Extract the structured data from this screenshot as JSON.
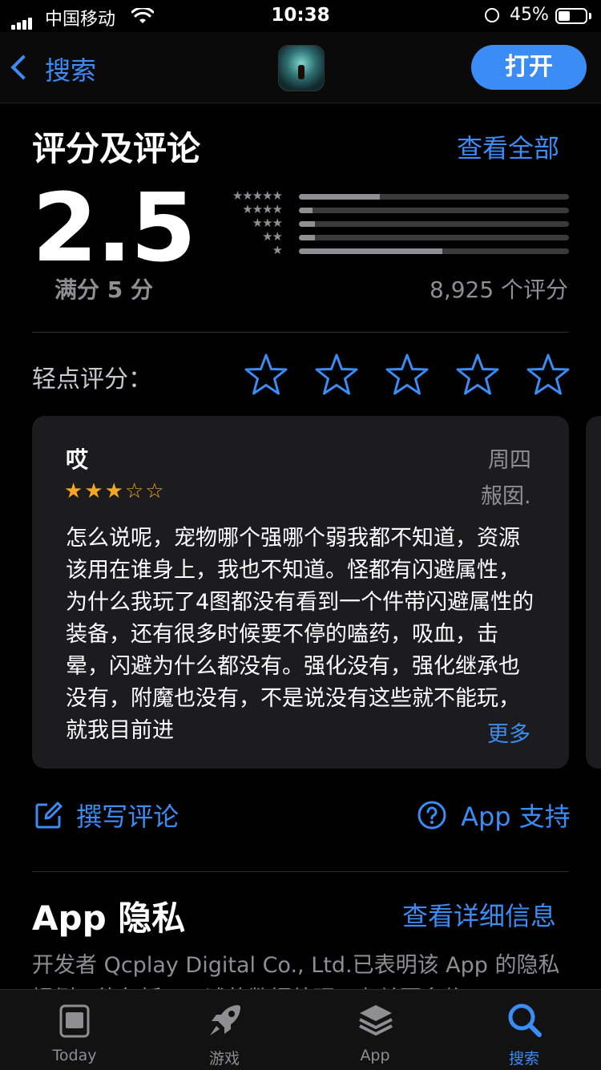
{
  "status": {
    "carrier": "中国移动",
    "time": "10:38",
    "battery": "45%"
  },
  "nav": {
    "back_label": "搜索",
    "open_label": "打开"
  },
  "ratings": {
    "title": "评分及评论",
    "see_all": "查看全部",
    "score": "2.5",
    "out_of": "满分 5 分",
    "count": "8,925 个评分",
    "distribution": [
      {
        "stars": "★★★★★",
        "fraction": 0.3
      },
      {
        "stars": "★★★★",
        "fraction": 0.05
      },
      {
        "stars": "★★★",
        "fraction": 0.06
      },
      {
        "stars": "★★",
        "fraction": 0.06
      },
      {
        "stars": "★",
        "fraction": 0.53
      }
    ],
    "tap_to_rate": "轻点评分："
  },
  "review": {
    "title": "哎",
    "date": "周四",
    "author": "赧囡.",
    "stars": "★★★☆☆",
    "star_count": 3,
    "body": "怎么说呢，宠物哪个强哪个弱我都不知道，资源该用在谁身上，我也不知道。怪都有闪避属性，为什么我玩了4图都没有看到一个件带闪避属性的装备，还有很多时候要不停的嗑药，吸血，击晕，闪避为什么都没有。强化没有，强化继承也没有，附魔也没有，不是说没有这些就不能玩，就我目前进",
    "more": "更多"
  },
  "actions": {
    "write_review": "撰写评论",
    "app_support": "App 支持"
  },
  "privacy": {
    "title": "App 隐私",
    "details": "查看详细信息",
    "text": "开发者 Qcplay Digital Co., Ltd.已表明该 App 的隐私慣例可能包括了下述的数据处理。有关更多信"
  },
  "tabs": [
    {
      "label": "Today",
      "icon": "today-icon",
      "active": false
    },
    {
      "label": "游戏",
      "icon": "rocket-icon",
      "active": false
    },
    {
      "label": "App",
      "icon": "layers-icon",
      "active": false
    },
    {
      "label": "搜索",
      "icon": "search-icon",
      "active": true
    }
  ],
  "colors": {
    "accent": "#3b8cf4",
    "star": "#f5a623",
    "card": "#1c1c1e"
  }
}
